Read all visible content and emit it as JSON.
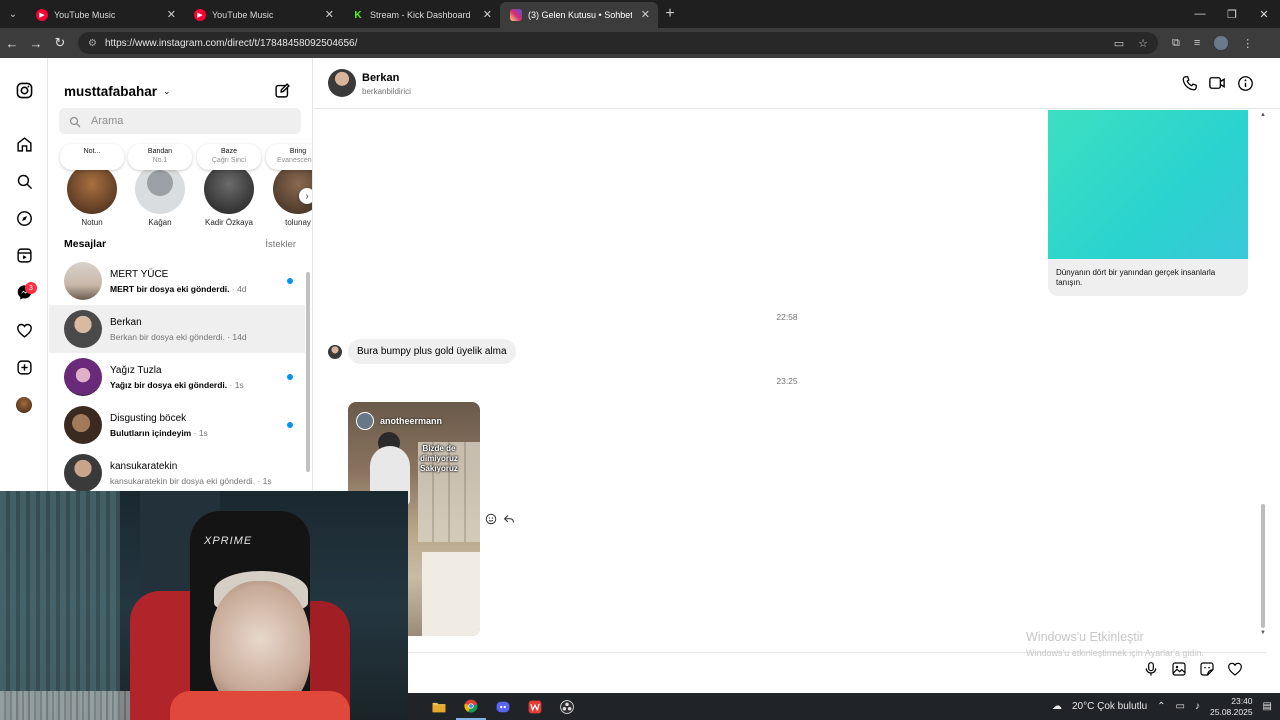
{
  "browser": {
    "tabs": [
      {
        "title": "YouTube Music",
        "icon": "youtube-music-icon",
        "active": false
      },
      {
        "title": "YouTube Music",
        "icon": "youtube-music-icon",
        "active": false
      },
      {
        "title": "Stream - Kick Dashboard",
        "icon": "kick-icon",
        "active": false
      },
      {
        "title": "(3) Gelen Kutusu • Sohbetler",
        "icon": "instagram-icon",
        "active": true
      }
    ],
    "url": "https://www.instagram.com/direct/t/17848458092504656/"
  },
  "rail": {
    "notification_badge": "3"
  },
  "inbox": {
    "account_name": "musttafabahar",
    "search_placeholder": "Arama",
    "notes": [
      {
        "bubble": "Not...",
        "sub": "",
        "name": "Notun"
      },
      {
        "bubble": "Bandan",
        "sub": "No.1",
        "name": "Kağan"
      },
      {
        "bubble": "Baze",
        "sub": "Çağrı Sinci",
        "name": "Kadir Özkaya"
      },
      {
        "bubble": "Bring",
        "sub": "Evanescence",
        "name": "tolunay"
      }
    ],
    "messages_title": "Mesajlar",
    "requests_label": "İstekler",
    "conversations": [
      {
        "name": "MERT YÜCE",
        "preview": "MERT bir dosya eki gönderdi.",
        "time": "· 4d",
        "unread": true
      },
      {
        "name": "Berkan",
        "preview": "Berkan bir dosya eki gönderdi.",
        "time": "· 14d",
        "unread": false
      },
      {
        "name": "Yağız Tuzla",
        "preview": "Yağız bir dosya eki gönderdi.",
        "time": "· 1s",
        "unread": true
      },
      {
        "name": "Disgusting böcek",
        "preview": "Bulutların içindeyim",
        "time": "· 1s",
        "unread": true
      },
      {
        "name": "kansukaratekin",
        "preview": "kansukaratekin bir dosya eki gönderdi.",
        "time": "· 1s",
        "unread": false
      }
    ]
  },
  "chat": {
    "name": "Berkan",
    "username": "berkanbildirici",
    "card_caption": "Dünyanın dört bir yanından gerçek insanlarla tanışın.",
    "timestamp_1": "22:58",
    "message_1": "Bura bumpy plus gold üyelik alma",
    "timestamp_2": "23:25",
    "reel_author": "anotheermann",
    "reel_text": "Bizde de dimiyoruz Sakıyoruz"
  },
  "watermark": {
    "line1": "Windows'u Etkinleştir",
    "line2": "Windows'u etkinleştirmek için Ayarlar'a gidin."
  },
  "webcam": {
    "brand": "XPRIME"
  },
  "taskbar": {
    "weather": "20°C  Çok bulutlu",
    "time": "23:40",
    "date": "25.08.2025"
  },
  "colors": {
    "accent_blue": "#0095f6",
    "badge_red": "#ff3040"
  }
}
